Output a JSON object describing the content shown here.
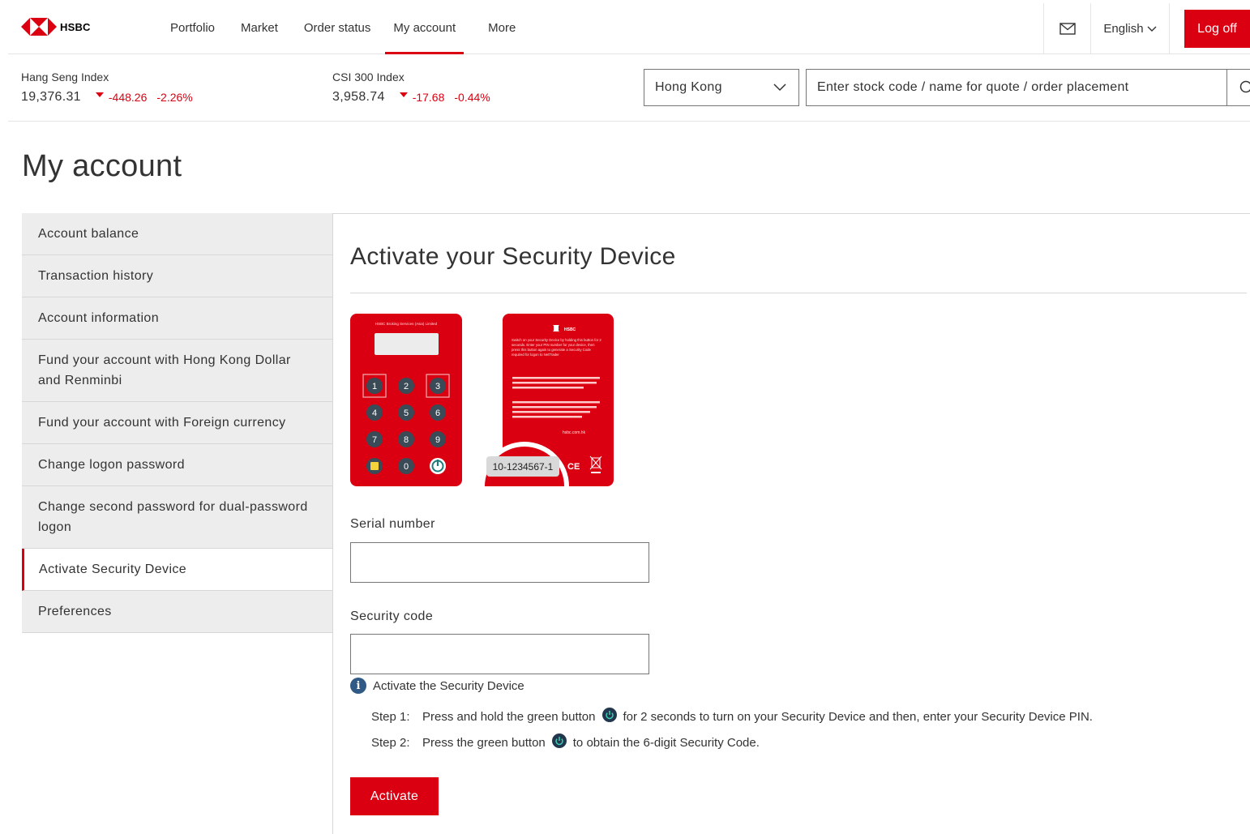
{
  "brand": {
    "name": "HSBC",
    "accent": "#db0011"
  },
  "nav": {
    "items": [
      {
        "label": "Portfolio",
        "active": false
      },
      {
        "label": "Market",
        "active": false
      },
      {
        "label": "Order status",
        "active": false
      },
      {
        "label": "My account",
        "active": true
      },
      {
        "label": "More",
        "active": false
      }
    ],
    "mail_icon": "envelope-icon",
    "language": "English",
    "logoff": "Log off"
  },
  "ticker": {
    "indices": [
      {
        "name": "Hang Seng Index",
        "value": "19,376.31",
        "change": "-448.26",
        "percent": "-2.26%"
      },
      {
        "name": "CSI 300 Index",
        "value": "3,958.74",
        "change": "-17.68",
        "percent": "-0.44%"
      }
    ],
    "market": "Hong Kong",
    "search_placeholder": "Enter stock code / name for quote / order placement"
  },
  "page": {
    "title": "My account"
  },
  "sidebar": {
    "items": [
      {
        "label": "Account balance",
        "active": false
      },
      {
        "label": "Transaction history",
        "active": false
      },
      {
        "label": "Account information",
        "active": false
      },
      {
        "label": "Fund your account with Hong Kong Dollar and Renminbi",
        "active": false
      },
      {
        "label": "Fund your account with Foreign currency",
        "active": false
      },
      {
        "label": "Change logon password",
        "active": false
      },
      {
        "label": "Change second password for dual-password logon",
        "active": false
      },
      {
        "label": "Activate Security Device",
        "active": true
      },
      {
        "label": "Preferences",
        "active": false
      }
    ]
  },
  "main": {
    "heading": "Activate your Security Device",
    "device_front": {
      "header": "HSBC Broking Services (Asia) Limited",
      "keys": [
        "1",
        "2",
        "3",
        "4",
        "5",
        "6",
        "7",
        "8",
        "9",
        "0"
      ]
    },
    "device_back": {
      "brand": "HSBC",
      "instructions": "Switch on your Security Device by holding this button for 2 seconds. Enter your PIN number for your device, then press this button again to generate a Security Code required for logon to NetTrader",
      "website": "hsbc.com.hk",
      "serial": "10-1234567-1"
    },
    "serial_label": "Serial number",
    "serial_value": "",
    "code_label": "Security code",
    "code_value": "",
    "info_title": "Activate the Security Device",
    "steps": [
      {
        "num": "Step 1:",
        "before": "Press and hold the green button",
        "after": "for 2 seconds to turn on your Security Device and then, enter your Security Device PIN."
      },
      {
        "num": "Step 2:",
        "before": "Press the green button",
        "after": "to obtain the 6-digit Security Code."
      }
    ],
    "activate_button": "Activate"
  }
}
